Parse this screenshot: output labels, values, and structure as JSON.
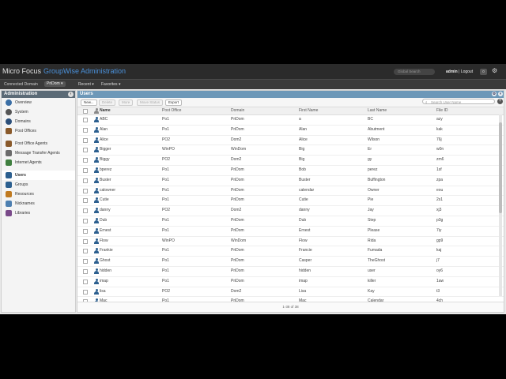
{
  "app": {
    "brand": "Micro Focus",
    "product": "GroupWise Administration",
    "global_search_placeholder": "Global Search",
    "user_name": "admin",
    "logout_label": "Logout",
    "notification_count": "0"
  },
  "subbar": {
    "connected_label": "Connected Domain",
    "connected_domain": "PriDom",
    "recent_label": "Recent",
    "favorites_label": "Favorites"
  },
  "sidebar": {
    "title": "Administration",
    "items": [
      {
        "label": "Overview",
        "icon": "overview-icon",
        "color": "#3a6ea5"
      },
      {
        "label": "System",
        "icon": "system-icon",
        "color": "#555555"
      },
      {
        "label": "Domains",
        "icon": "domains-icon",
        "color": "#2b4f7a"
      },
      {
        "label": "Post Offices",
        "icon": "post-offices-icon",
        "color": "#8a5a2b"
      },
      {
        "label": "Post Office Agents",
        "icon": "poa-icon",
        "color": "#8a5a2b"
      },
      {
        "label": "Message Transfer Agents",
        "icon": "mta-icon",
        "color": "#6b6b6b"
      },
      {
        "label": "Internet Agents",
        "icon": "gwia-icon",
        "color": "#3f7f3f"
      },
      {
        "label": "Users",
        "icon": "users-icon",
        "color": "#2c5f8f"
      },
      {
        "label": "Groups",
        "icon": "groups-icon",
        "color": "#2c5f8f"
      },
      {
        "label": "Resources",
        "icon": "resources-icon",
        "color": "#c07a20"
      },
      {
        "label": "Nicknames",
        "icon": "nicknames-icon",
        "color": "#4d7fb0"
      },
      {
        "label": "Libraries",
        "icon": "libraries-icon",
        "color": "#7a4a8a"
      }
    ],
    "selected": "Users"
  },
  "users_panel": {
    "title": "Users",
    "toolbar": {
      "new_label": "New...",
      "delete_label": "Delete",
      "more_label": "More",
      "move_status_label": "Move Status",
      "export_label": "Export",
      "search_placeholder": "Search User Name"
    },
    "columns": [
      "Name",
      "Post Office",
      "Domain",
      "First Name",
      "Last Name",
      "File ID"
    ],
    "rows": [
      {
        "name": "ABC",
        "post_office": "Po1",
        "domain": "PriDom",
        "first_name": "a",
        "last_name": "BC",
        "file_id": "azy"
      },
      {
        "name": "Alan",
        "post_office": "Po1",
        "domain": "PriDom",
        "first_name": "Alan",
        "last_name": "Abutment",
        "file_id": "kak"
      },
      {
        "name": "Alice",
        "post_office": "PO2",
        "domain": "Dom2",
        "first_name": "Alice",
        "last_name": "Wilson",
        "file_id": "76j"
      },
      {
        "name": "Bigger",
        "post_office": "WinPO",
        "domain": "WinDom",
        "first_name": "Big",
        "last_name": "Er",
        "file_id": "w0n"
      },
      {
        "name": "Biggy",
        "post_office": "PO2",
        "domain": "Dom2",
        "first_name": "Big",
        "last_name": "gy",
        "file_id": "zm6"
      },
      {
        "name": "bperez",
        "post_office": "Po1",
        "domain": "PriDom",
        "first_name": "Bob",
        "last_name": "perez",
        "file_id": "1sf"
      },
      {
        "name": "Buster",
        "post_office": "Po1",
        "domain": "PriDom",
        "first_name": "Buster",
        "last_name": "Buffington",
        "file_id": "zpa"
      },
      {
        "name": "calowner",
        "post_office": "Po1",
        "domain": "PriDom",
        "first_name": "calendar",
        "last_name": "Owner",
        "file_id": "eou"
      },
      {
        "name": "Cutie",
        "post_office": "Po1",
        "domain": "PriDom",
        "first_name": "Cutie",
        "last_name": "Pie",
        "file_id": "2s1"
      },
      {
        "name": "danny",
        "post_office": "PO2",
        "domain": "Dom2",
        "first_name": "danny",
        "last_name": "Jay",
        "file_id": "xj3"
      },
      {
        "name": "Dub",
        "post_office": "Po1",
        "domain": "PriDom",
        "first_name": "Dub",
        "last_name": "Step",
        "file_id": "p3g"
      },
      {
        "name": "Ernest",
        "post_office": "Po1",
        "domain": "PriDom",
        "first_name": "Ernest",
        "last_name": "Please",
        "file_id": "7iy"
      },
      {
        "name": "Flow",
        "post_office": "WinPO",
        "domain": "WinDom",
        "first_name": "Flow",
        "last_name": "Rida",
        "file_id": "gp9"
      },
      {
        "name": "Frankie",
        "post_office": "Po1",
        "domain": "PriDom",
        "first_name": "Francie",
        "last_name": "Fumada",
        "file_id": "kaj"
      },
      {
        "name": "Ghost",
        "post_office": "Po1",
        "domain": "PriDom",
        "first_name": "Casper",
        "last_name": "TheGhost",
        "file_id": "j7"
      },
      {
        "name": "hidden",
        "post_office": "Po1",
        "domain": "PriDom",
        "first_name": "hidden",
        "last_name": "user",
        "file_id": "oy6"
      },
      {
        "name": "imap",
        "post_office": "Po1",
        "domain": "PriDom",
        "first_name": "imap",
        "last_name": "killer",
        "file_id": "1aw"
      },
      {
        "name": "lisa",
        "post_office": "PO2",
        "domain": "Dom2",
        "first_name": "Lisa",
        "last_name": "Kay",
        "file_id": "t3"
      },
      {
        "name": "Mac",
        "post_office": "Po1",
        "domain": "PriDom",
        "first_name": "Mac",
        "last_name": "Calendar",
        "file_id": "4ch"
      }
    ],
    "pager": "1-38 of 38"
  }
}
